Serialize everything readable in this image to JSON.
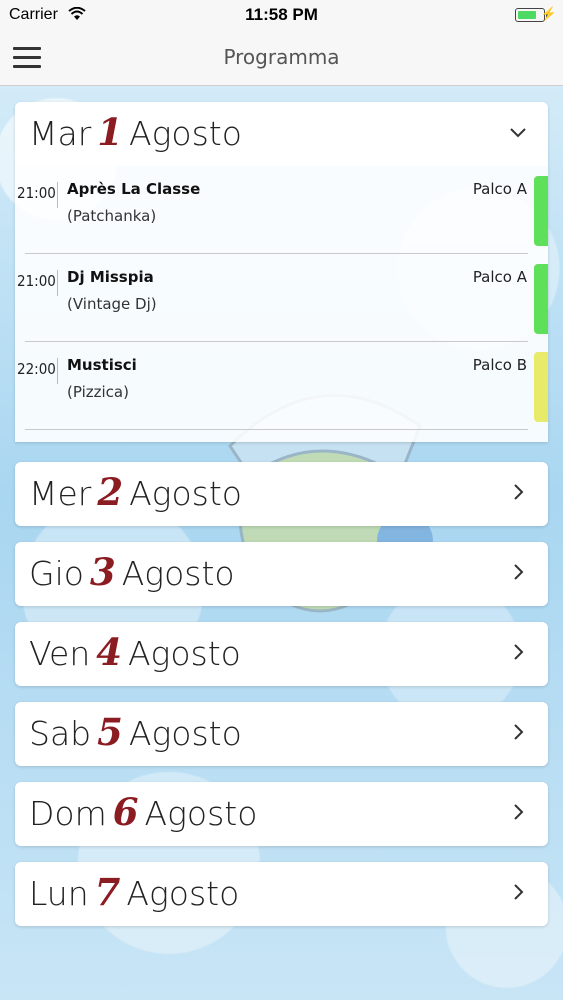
{
  "status_bar": {
    "carrier": "Carrier",
    "time": "11:58 PM",
    "battery_level": 0.8
  },
  "nav": {
    "title": "Programma",
    "menu_icon": "hamburger-menu-icon"
  },
  "colors": {
    "day_number": "#8b1c22",
    "stage_a": "#5ee05a",
    "stage_b": "#e8ea6a"
  },
  "days": [
    {
      "weekday": "Mar",
      "number": "1",
      "month": "Agosto",
      "expanded": true,
      "events": [
        {
          "time": "21:00",
          "name": "Après La Classe",
          "genre": "(Patchanka)",
          "stage": "Palco A",
          "color": "#5ee05a"
        },
        {
          "time": "21:00",
          "name": "Dj Misspia",
          "genre": "(Vintage Dj)",
          "stage": "Palco A",
          "color": "#5ee05a"
        },
        {
          "time": "22:00",
          "name": "Mustisci",
          "genre": "(Pizzica)",
          "stage": "Palco B",
          "color": "#e8ea6a"
        }
      ]
    },
    {
      "weekday": "Mer",
      "number": "2",
      "month": "Agosto",
      "expanded": false
    },
    {
      "weekday": "Gio",
      "number": "3",
      "month": "Agosto",
      "expanded": false
    },
    {
      "weekday": "Ven",
      "number": "4",
      "month": "Agosto",
      "expanded": false
    },
    {
      "weekday": "Sab",
      "number": "5",
      "month": "Agosto",
      "expanded": false
    },
    {
      "weekday": "Dom",
      "number": "6",
      "month": "Agosto",
      "expanded": false
    },
    {
      "weekday": "Lun",
      "number": "7",
      "month": "Agosto",
      "expanded": false
    }
  ]
}
